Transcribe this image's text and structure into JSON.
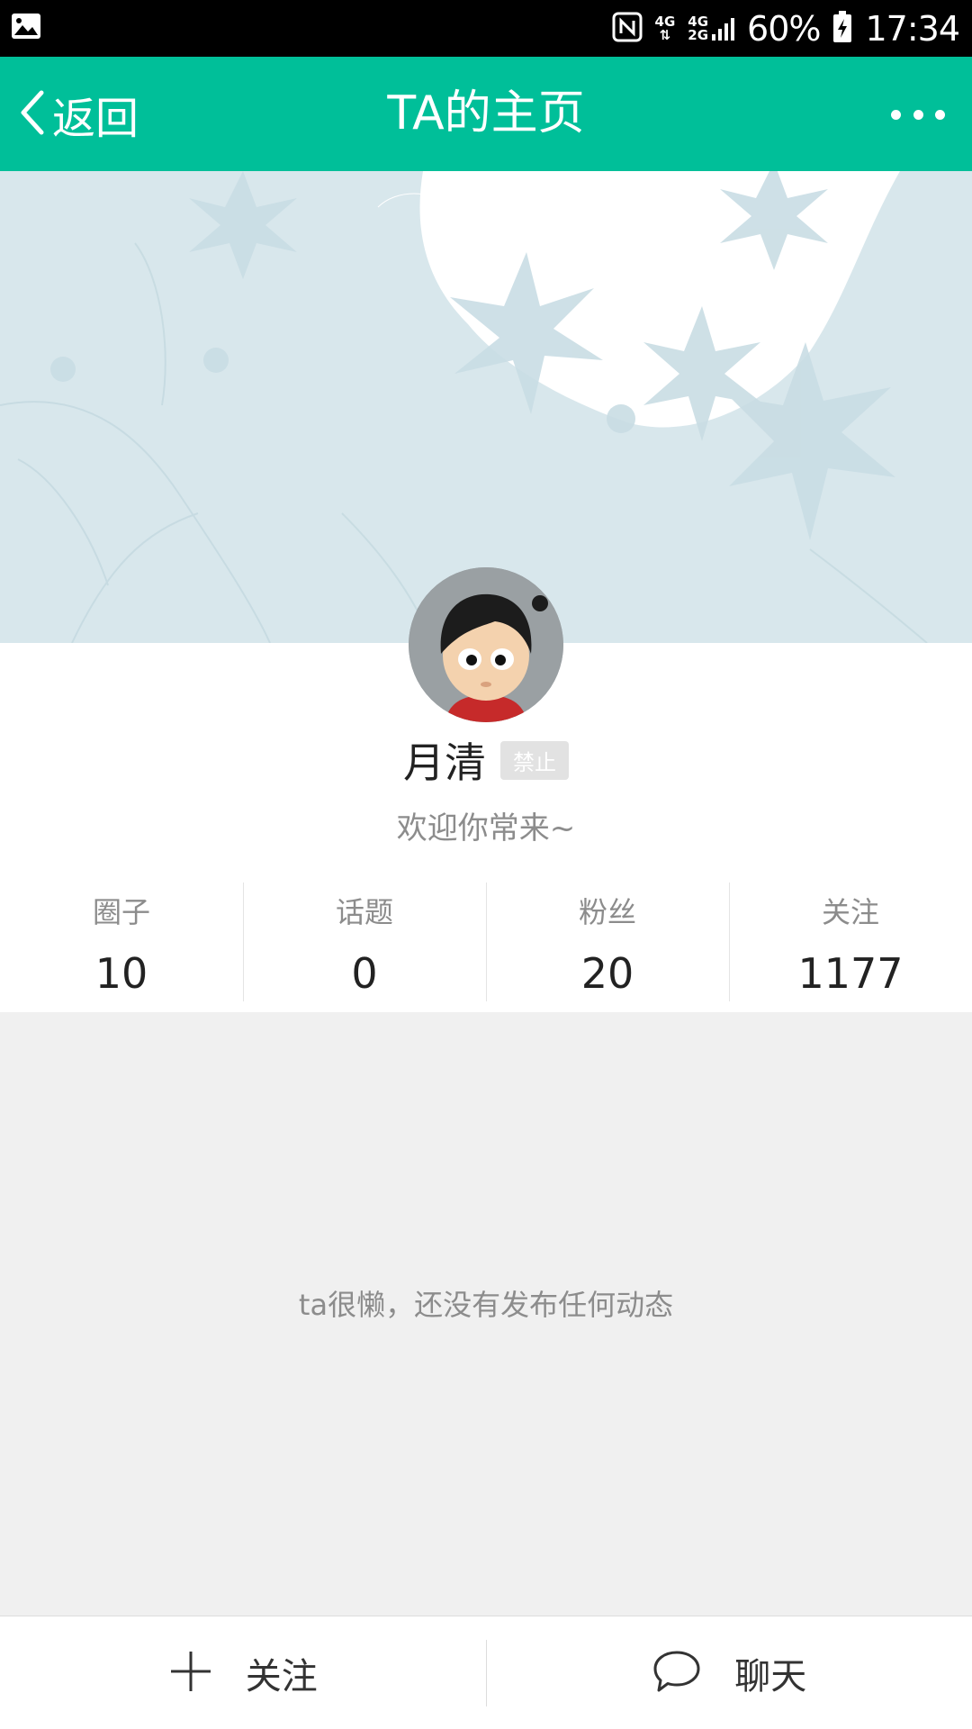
{
  "status_bar": {
    "network1": "4G",
    "network2": "4G",
    "network3": "2G",
    "battery": "60%",
    "time": "17:34"
  },
  "header": {
    "back_label": "返回",
    "title": "TA的主页"
  },
  "profile": {
    "name": "月清",
    "badge": "禁止",
    "bio": "欢迎你常来~"
  },
  "stats": [
    {
      "label": "圈子",
      "value": "10"
    },
    {
      "label": "话题",
      "value": "0"
    },
    {
      "label": "粉丝",
      "value": "20"
    },
    {
      "label": "关注",
      "value": "1177"
    }
  ],
  "feed": {
    "empty_text": "ta很懒，还没有发布任何动态"
  },
  "bottom_bar": {
    "follow_label": "关注",
    "chat_label": "聊天"
  },
  "colors": {
    "accent": "#00bf99",
    "cover": "#d8e7ec",
    "feed_bg": "#f0f0f0"
  },
  "icons": [
    "image-icon",
    "nfc-icon",
    "signal-icon",
    "battery-icon",
    "back-chevron-icon",
    "more-icon",
    "plus-icon",
    "chat-bubble-icon"
  ]
}
